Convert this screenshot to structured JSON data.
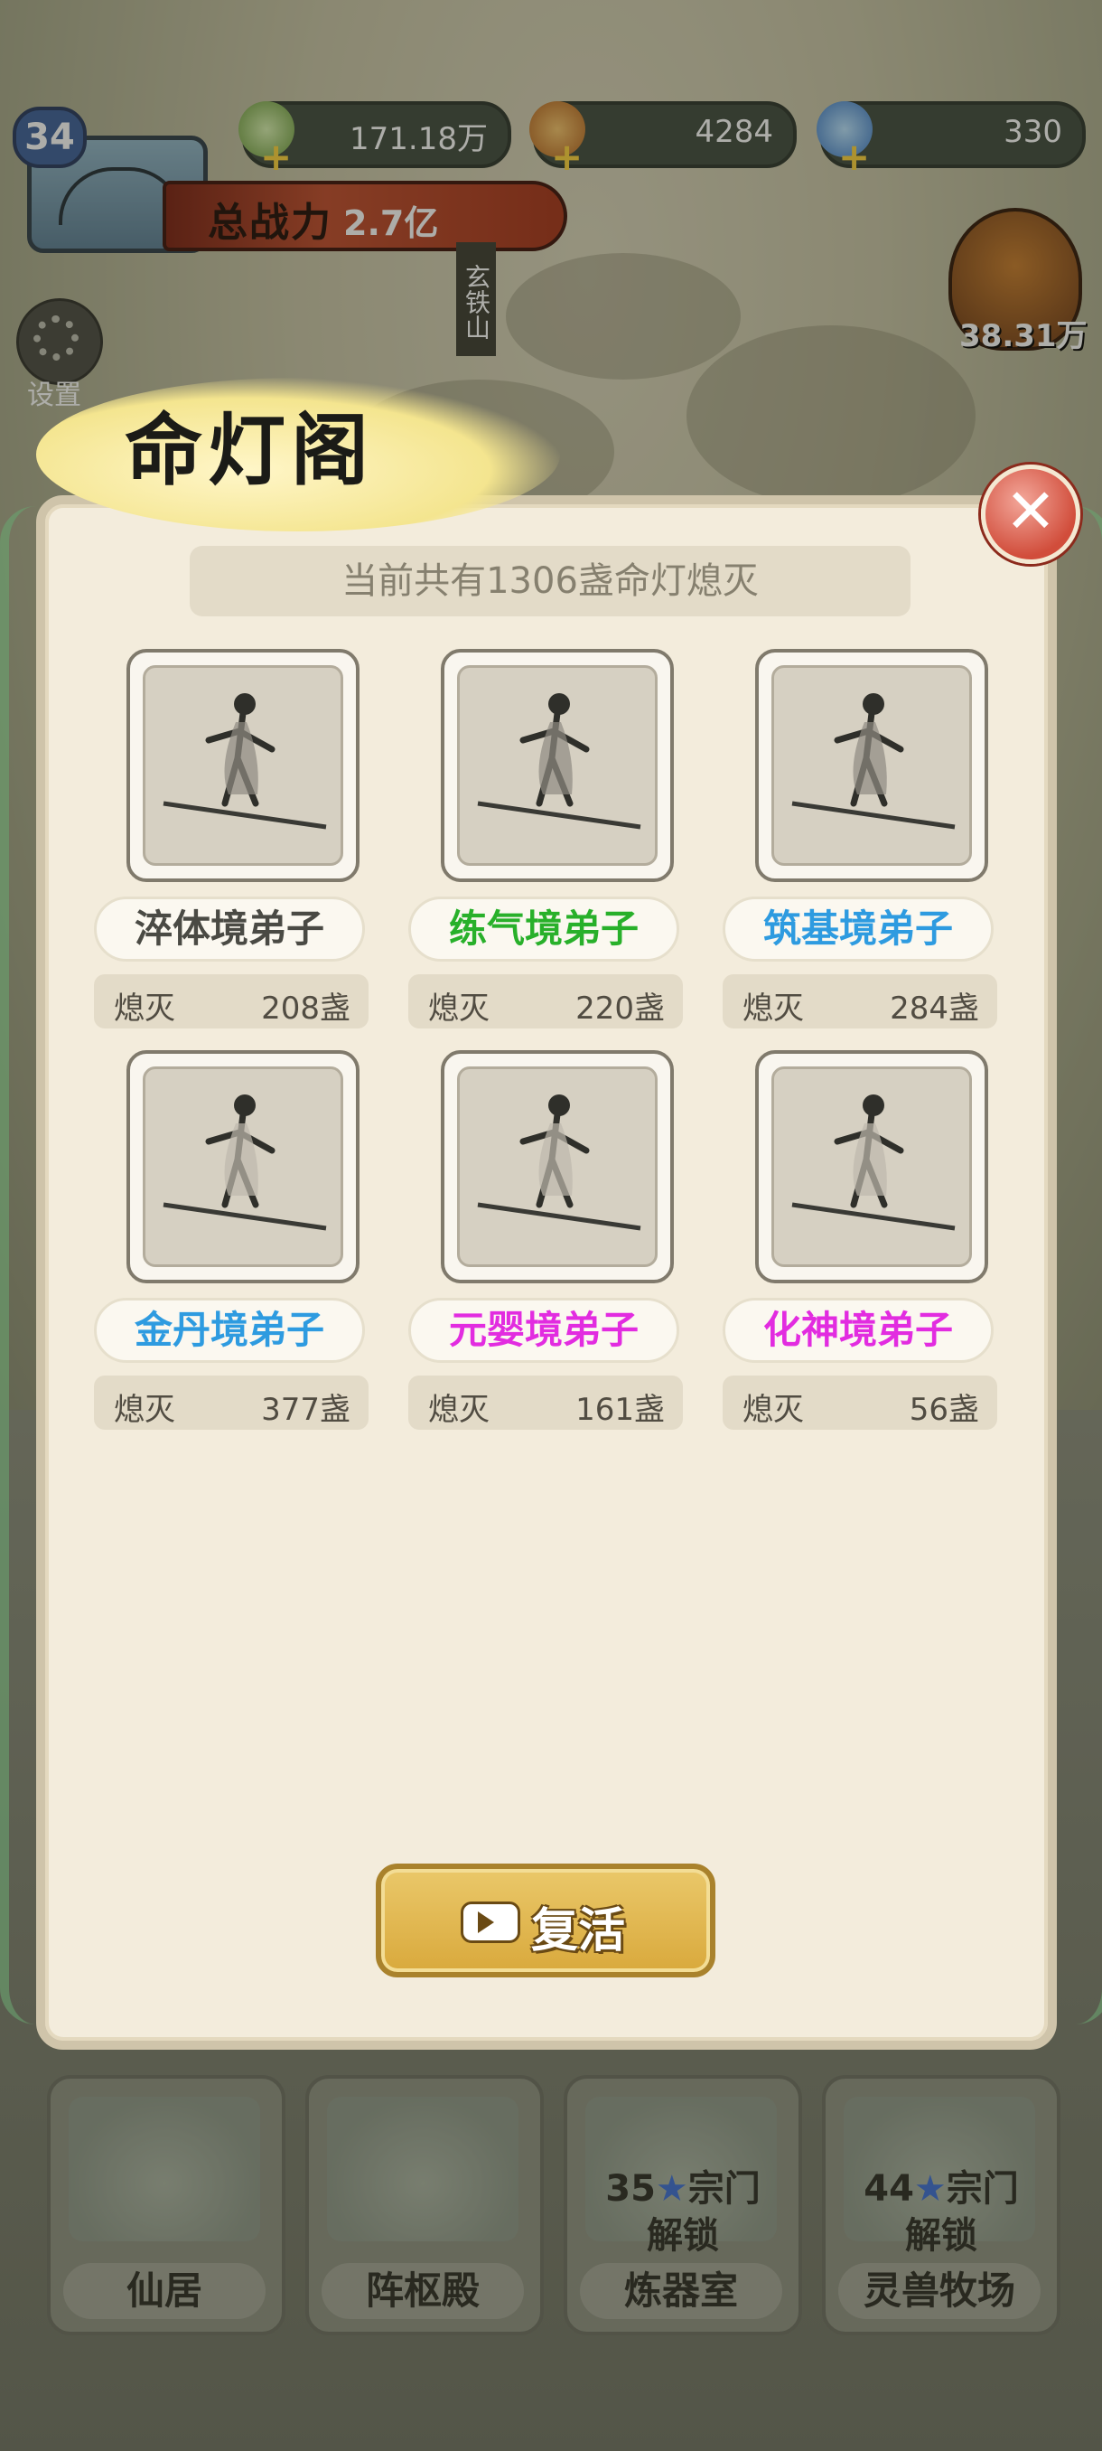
{
  "hud": {
    "level": "34",
    "power_label": "总战力",
    "power_value": "2.7亿",
    "resources": [
      {
        "icon": "jade-crystal-icon",
        "value": "171.18万"
      },
      {
        "icon": "spirit-stone-icon",
        "value": "4284"
      },
      {
        "icon": "blue-gem-icon",
        "value": "330"
      }
    ],
    "location_sign": "玄铁山",
    "settings_label": "设置",
    "bag_value": "38.31万"
  },
  "modal": {
    "title": "命灯阁",
    "summary": "当前共有1306盏命灯熄灭",
    "disciples": [
      {
        "rank": "淬体境弟子",
        "color": "#4a4a44",
        "count_label": "熄灭",
        "count": "208盏"
      },
      {
        "rank": "练气境弟子",
        "color": "#28b02a",
        "count_label": "熄灭",
        "count": "220盏"
      },
      {
        "rank": "筑基境弟子",
        "color": "#2e9be0",
        "count_label": "熄灭",
        "count": "284盏"
      },
      {
        "rank": "金丹境弟子",
        "color": "#2e9be0",
        "count_label": "熄灭",
        "count": "377盏"
      },
      {
        "rank": "元婴境弟子",
        "color": "#e22ce0",
        "count_label": "熄灭",
        "count": "161盏"
      },
      {
        "rank": "化神境弟子",
        "color": "#e22ce0",
        "count_label": "熄灭",
        "count": "56盏"
      }
    ],
    "revive_label": "复活"
  },
  "buildings": [
    {
      "label": "仙居"
    },
    {
      "label": "阵枢殿"
    },
    {
      "label": "炼器室",
      "unlock_count": "35",
      "unlock_text1": "宗门",
      "unlock_text2": "解锁"
    },
    {
      "label": "灵兽牧场",
      "unlock_count": "44",
      "unlock_text1": "宗门",
      "unlock_text2": "解锁"
    }
  ]
}
